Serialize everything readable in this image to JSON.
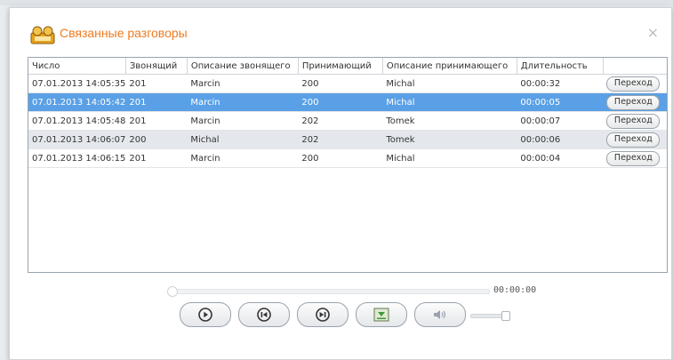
{
  "dialog": {
    "title": "Связанные разговоры",
    "close_label": "×"
  },
  "table": {
    "columns": [
      "Число",
      "Звонящий",
      "Описание звонящего",
      "Принимающий",
      "Описание принимающего",
      "Длительность",
      ""
    ],
    "rows": [
      {
        "date": "07.01.2013 14:05:35",
        "caller": "201",
        "caller_desc": "Marcin",
        "receiver": "200",
        "receiver_desc": "Michal",
        "duration": "00:00:32",
        "action": "Переход"
      },
      {
        "date": "07.01.2013 14:05:42",
        "caller": "201",
        "caller_desc": "Marcin",
        "receiver": "200",
        "receiver_desc": "Michal",
        "duration": "00:00:05",
        "action": "Переход"
      },
      {
        "date": "07.01.2013 14:05:48",
        "caller": "201",
        "caller_desc": "Marcin",
        "receiver": "202",
        "receiver_desc": "Tomek",
        "duration": "00:00:07",
        "action": "Переход"
      },
      {
        "date": "07.01.2013 14:06:07",
        "caller": "200",
        "caller_desc": "Michal",
        "receiver": "202",
        "receiver_desc": "Tomek",
        "duration": "00:00:06",
        "action": "Переход"
      },
      {
        "date": "07.01.2013 14:06:15",
        "caller": "201",
        "caller_desc": "Marcin",
        "receiver": "200",
        "receiver_desc": "Michal",
        "duration": "00:00:04",
        "action": "Переход"
      }
    ],
    "selected_row": 1
  },
  "player": {
    "time": "00:00:00",
    "buttons": [
      {
        "name": "play-button",
        "icon": "play-icon"
      },
      {
        "name": "previous-button",
        "icon": "previous-icon"
      },
      {
        "name": "next-button",
        "icon": "next-icon"
      },
      {
        "name": "download-button",
        "icon": "download-icon"
      },
      {
        "name": "volume-button",
        "icon": "speaker-icon"
      }
    ]
  }
}
